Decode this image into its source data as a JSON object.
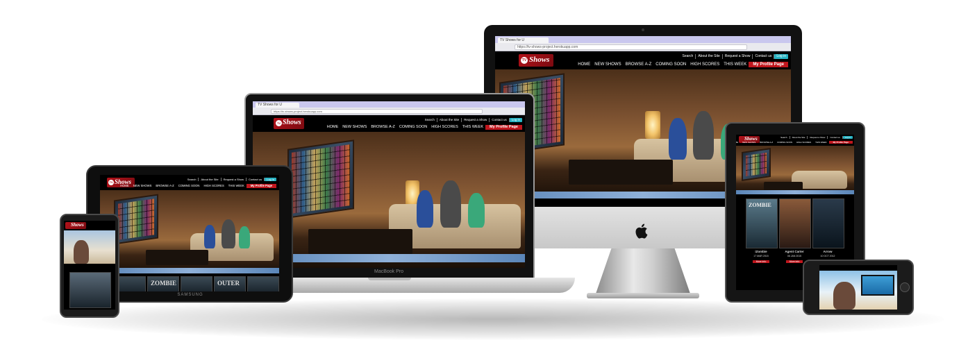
{
  "site": {
    "tab_title": "TV Shows for U",
    "url": "https://tv-shows-project.herokuapp.com",
    "logo_badge": "TV",
    "logo_text": "Shows",
    "top_nav": [
      "Search",
      "About the Site",
      "Request a Show",
      "Contact us"
    ],
    "login_label": "Log in",
    "main_nav": [
      "HOME",
      "NEW SHOWS",
      "BROWSE A-Z",
      "COMING SOON",
      "HIGH SCORES",
      "THIS WEEK"
    ],
    "profile_label": "My Profile Page"
  },
  "laptop": {
    "brand": "MacBook Pro"
  },
  "tablet_landscape": {
    "brand": "SAMSUNG",
    "posters": [
      "ZOMBIE",
      "OUTER"
    ]
  },
  "tablet_portrait": {
    "posters": [
      "ZOMBIE",
      "",
      ""
    ],
    "shows": [
      {
        "title": "iZombie",
        "date": "17 MAR 2015",
        "button": "More info"
      },
      {
        "title": "Agent Carter",
        "date": "06 JAN 2015",
        "button": "More info"
      },
      {
        "title": "Arrow",
        "date": "10 OCT 2012",
        "button": "More info"
      }
    ]
  },
  "colors": {
    "accent_red": "#c0161d",
    "login_teal": "#27b3c3",
    "tab_strip": "#c9c7ee"
  },
  "icons": [
    "apple-logo-icon",
    "webcam-icon",
    "home-button-icon",
    "reload-icon",
    "back-icon",
    "forward-icon",
    "close-tab-icon"
  ]
}
